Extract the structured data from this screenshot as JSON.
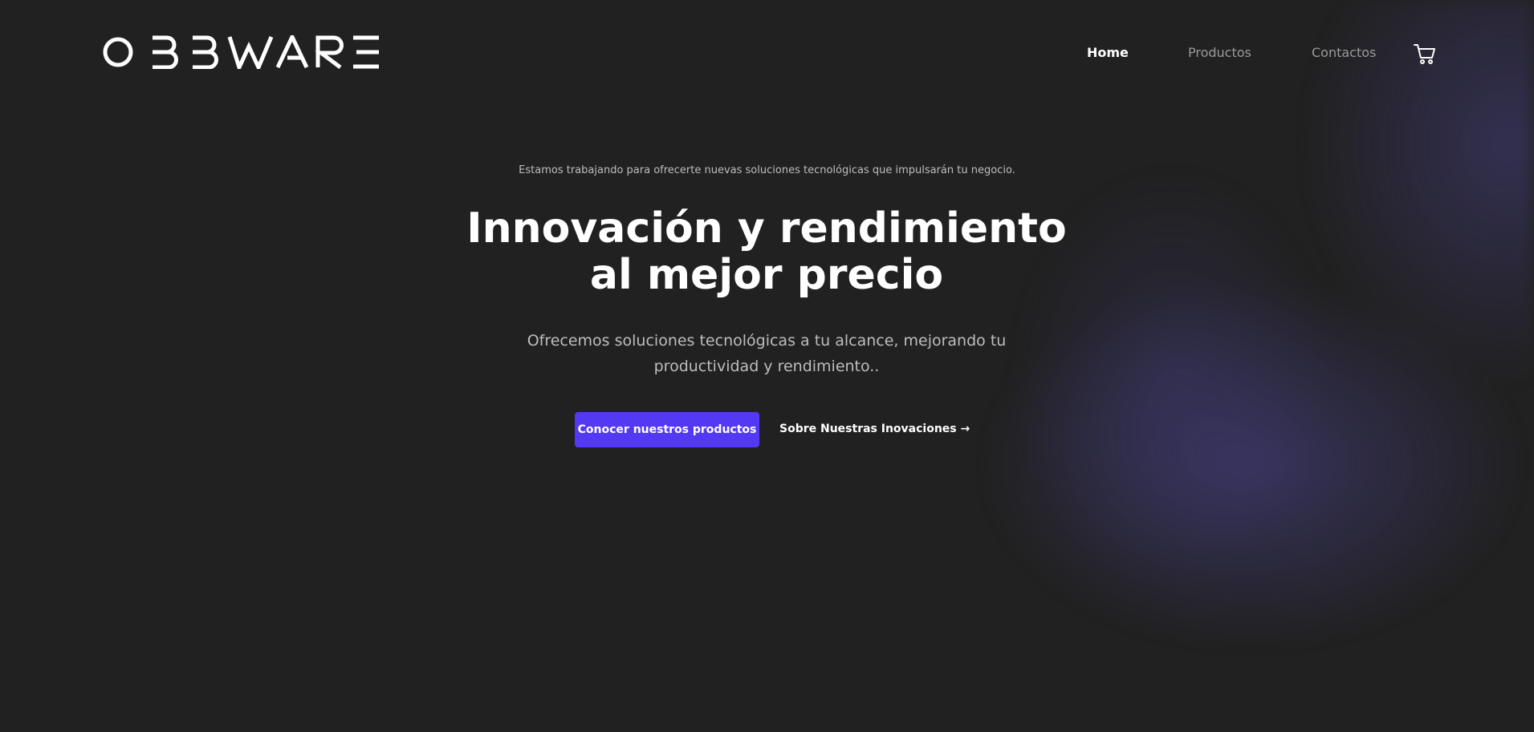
{
  "header": {
    "logo_text": "OBBWARE",
    "nav": [
      {
        "label": "Home"
      },
      {
        "label": "Productos"
      },
      {
        "label": "Contactos"
      }
    ],
    "cart_icon": "shopping-cart-icon"
  },
  "hero": {
    "eyebrow": "Estamos trabajando para ofrecerte nuevas soluciones tecnológicas que impulsarán tu negocio.",
    "title_line1": "Innovación y rendimiento",
    "title_line2": "al mejor precio",
    "subtitle": "Ofrecemos soluciones tecnológicas a tu alcance, mejorando tu productividad y rendimiento..",
    "primary_cta": "Conocer nuestros productos",
    "secondary_cta": "Sobre Nuestras Inovaciones →"
  },
  "colors": {
    "background": "#212121",
    "accent": "#5439f4",
    "text_primary": "#ffffff",
    "text_muted": "#9a9a9a"
  }
}
